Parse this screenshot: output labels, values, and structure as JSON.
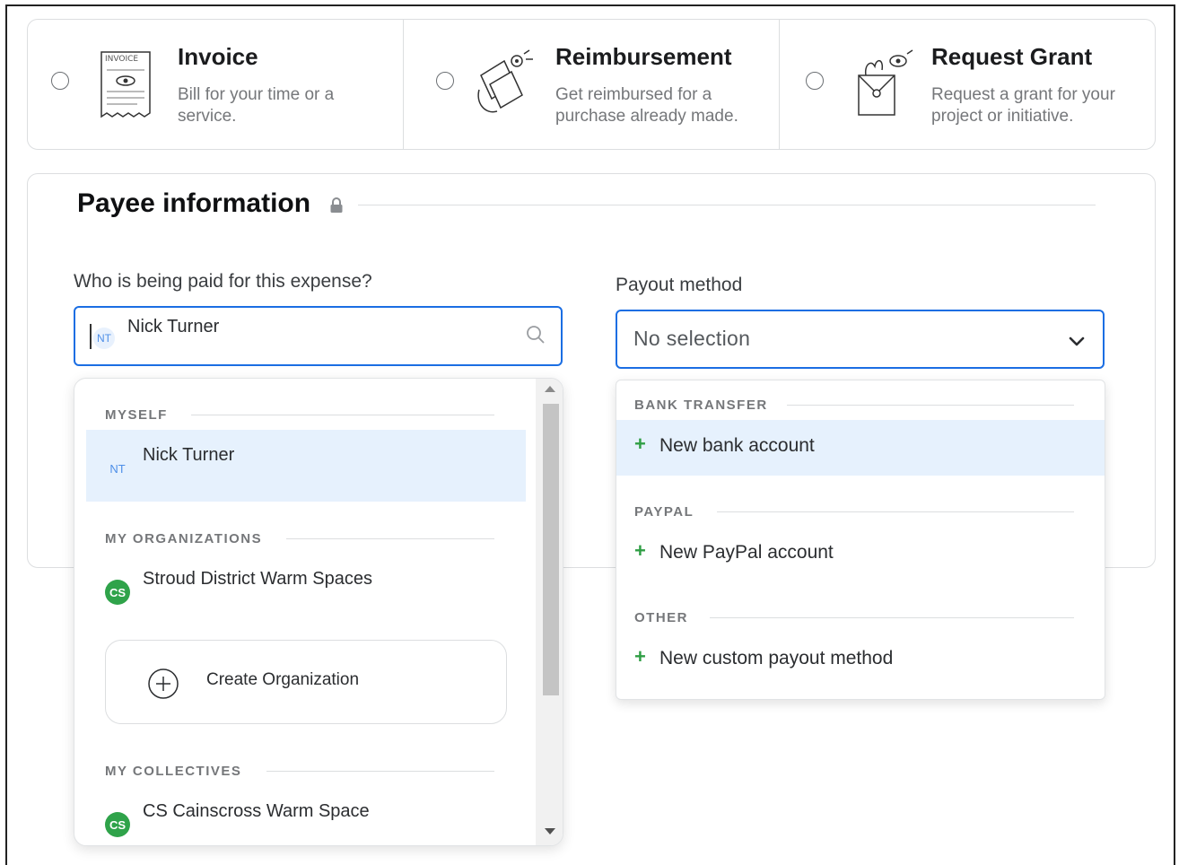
{
  "expense_types": [
    {
      "title": "Invoice",
      "description": "Bill for your time or a service.",
      "illustration": "invoice-illustration",
      "selected": false
    },
    {
      "title": "Reimbursement",
      "description": "Get reimbursed for a purchase already made.",
      "illustration": "receipts-illustration",
      "selected": false
    },
    {
      "title": "Request Grant",
      "description": "Request a grant for your project or initiative.",
      "illustration": "grant-envelope-illustration",
      "selected": false
    }
  ],
  "illustration_text": {
    "invoice": "INVOICE"
  },
  "payee": {
    "section_title": "Payee information",
    "question": "Who is being paid for this expense?",
    "value": "Nick Turner",
    "avatar_initials": "NT"
  },
  "payout": {
    "label": "Payout method",
    "value": "No selection"
  },
  "payee_menu": {
    "groups": [
      {
        "label": "MYSELF",
        "options": [
          {
            "label": "Nick Turner",
            "avatar": "NT",
            "highlighted": true
          }
        ]
      },
      {
        "label": "MY ORGANIZATIONS",
        "options": [
          {
            "label": "Stroud District Warm Spaces",
            "avatar": "CS"
          }
        ]
      },
      {
        "label": "MY COLLECTIVES",
        "options": [
          {
            "label": "CS Cainscross Warm Space",
            "avatar": "CS"
          }
        ]
      }
    ],
    "create_label": "Create Organization"
  },
  "payout_menu": {
    "groups": [
      {
        "label": "BANK TRANSFER",
        "option": "New bank account",
        "highlighted": true
      },
      {
        "label": "PAYPAL",
        "option": "New PayPal account"
      },
      {
        "label": "OTHER",
        "option": "New custom payout method"
      }
    ]
  },
  "colors": {
    "accent": "#1b6ee3",
    "highlight": "#e6f1fd",
    "plus_green": "#2f9e44",
    "org_avatar_green": "#2fa34a"
  }
}
